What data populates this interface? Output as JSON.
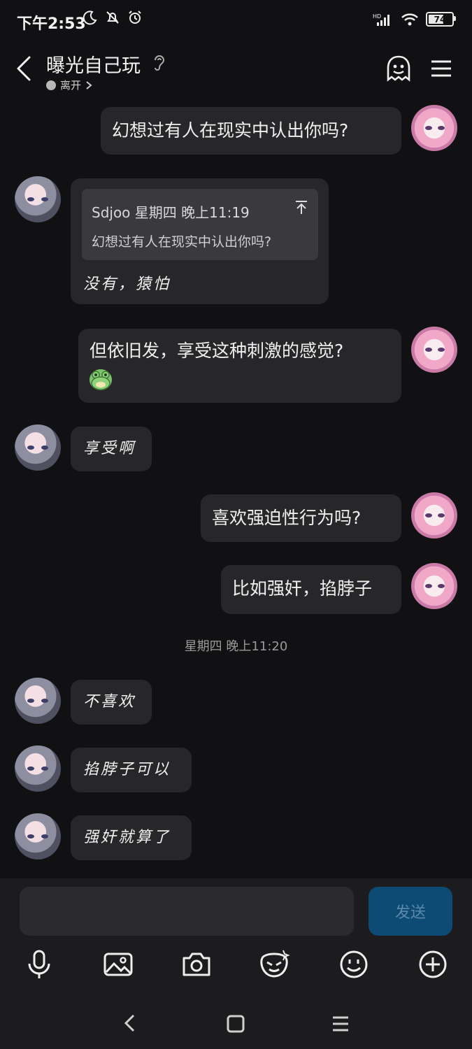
{
  "status_bar": {
    "time": "下午2:53",
    "battery": "74",
    "battery_level": 0.74,
    "network": "HD"
  },
  "header": {
    "title": "曝光自己玩",
    "presence": "离开"
  },
  "messages": [
    {
      "from": "me",
      "text": "幻想过有人在现实中认出你吗?"
    },
    {
      "from": "other",
      "quote_meta": "Sdjoo 星期四 晚上11:19",
      "quote_text": "幻想过有人在现实中认出你吗?",
      "text": "没有，猿怕"
    },
    {
      "from": "me",
      "text": "但依旧发，享受这种刺激的感觉?"
    },
    {
      "from": "other",
      "text": "享受啊"
    },
    {
      "from": "me",
      "text": "喜欢强迫性行为吗?"
    },
    {
      "from": "me",
      "text": "比如强奸，掐脖子"
    },
    {
      "from": "other",
      "text": "不喜欢"
    },
    {
      "from": "other",
      "text": "掐脖子可以"
    },
    {
      "from": "other",
      "text": "强奸就算了"
    }
  ],
  "timestamp_divider": "星期四 晚上11:20",
  "composer": {
    "send_label": "发送",
    "input_value": ""
  },
  "toolbar_icons": [
    "microphone-icon",
    "image-icon",
    "camera-icon",
    "sticker-icon",
    "emoji-icon",
    "plus-icon"
  ],
  "nav_icons": [
    "back-icon",
    "home-icon",
    "menu-icon"
  ],
  "colors": {
    "background": "#111113",
    "bubble": "#27272a",
    "send_button": "#0d4a74"
  }
}
